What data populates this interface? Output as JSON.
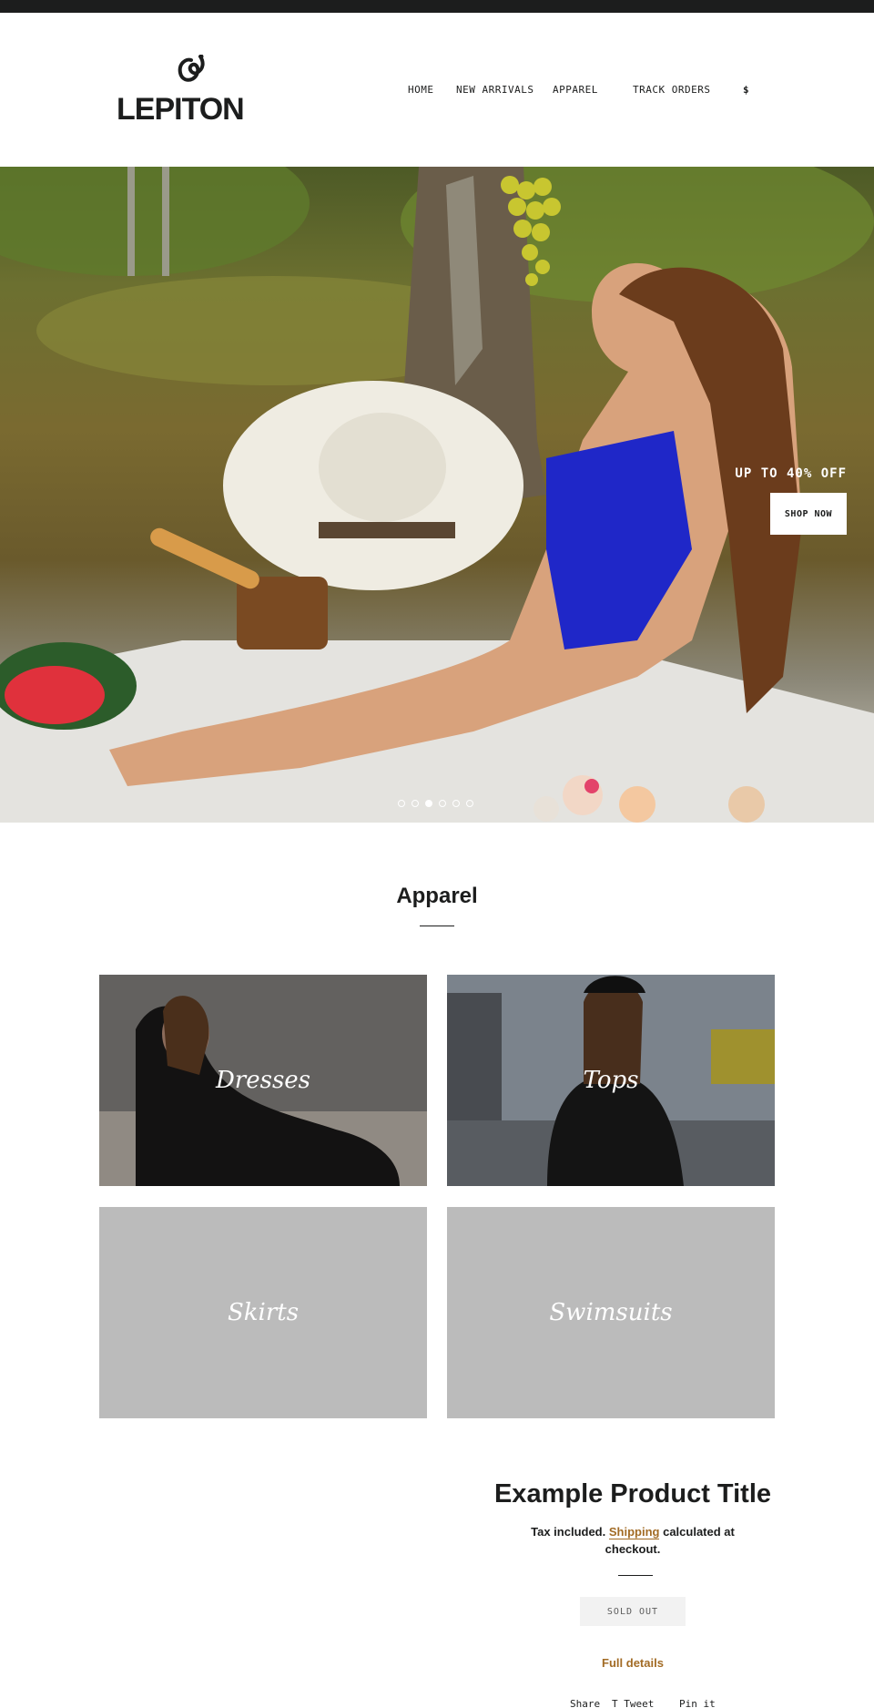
{
  "header": {
    "logo_text": "LEPITON",
    "nav": [
      "HOME",
      "NEW ARRIVALS",
      "APPAREL",
      "TRACK ORDERS"
    ],
    "currency": "$"
  },
  "hero": {
    "caption": "UP TO 40% OFF",
    "button_label": "SHOP NOW",
    "slide_count": 6,
    "active_slide": 3
  },
  "collection": {
    "title": "Apparel",
    "tiles": [
      {
        "label": "Dresses"
      },
      {
        "label": "Tops"
      },
      {
        "label": "Skirts"
      },
      {
        "label": "Swimsuits"
      }
    ]
  },
  "product": {
    "title": "Example Product Title",
    "tax_prefix": "Tax included.",
    "shipping_link": "Shipping",
    "tax_suffix": "calculated at checkout.",
    "button_label": "SOLD OUT",
    "details_link": "Full details",
    "share": [
      "Share",
      "T Tweet",
      "Pin it"
    ]
  },
  "colors": {
    "text": "#1c1d1d",
    "accent": "#a26b25",
    "placeholder_tile": "#bbbbbb"
  }
}
